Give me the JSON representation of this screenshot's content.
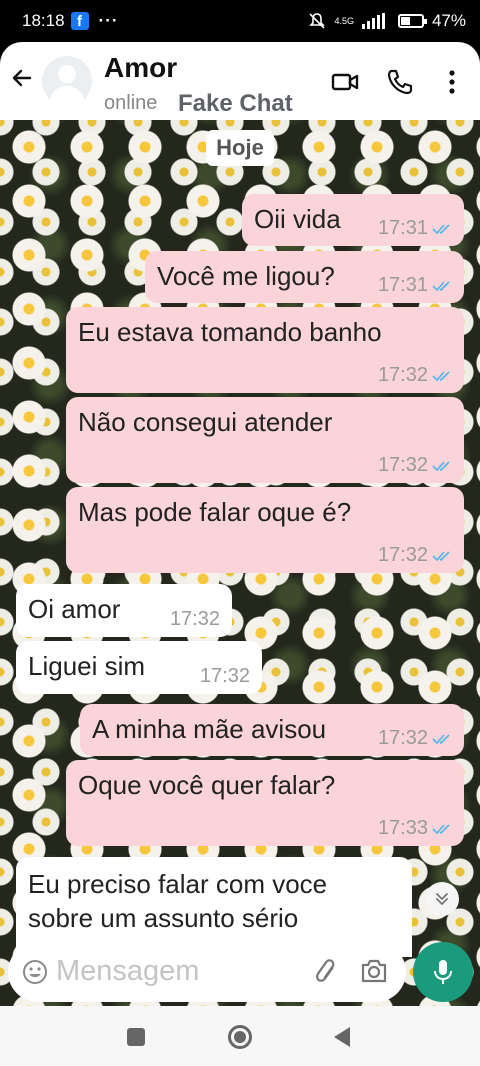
{
  "status_bar": {
    "time": "18:18",
    "app_notification_icon": "facebook-icon",
    "more_dots": "···",
    "network": "4.5G",
    "battery": "47%",
    "battery_level": 0.47
  },
  "header": {
    "contact_name": "Amor",
    "status": "online",
    "watermark": "Fake Chat"
  },
  "chat": {
    "date_label": "Hoje",
    "messages": [
      {
        "dir": "out",
        "text": "Oii vida",
        "time": "17:31"
      },
      {
        "dir": "out",
        "text": "Você me ligou?",
        "time": "17:31"
      },
      {
        "dir": "out",
        "text": "Eu estava tomando banho",
        "time": "17:32"
      },
      {
        "dir": "out",
        "text": "Não consegui atender",
        "time": "17:32"
      },
      {
        "dir": "out",
        "text": "Mas pode falar oque é?",
        "time": "17:32"
      },
      {
        "dir": "in",
        "text": "Oi amor",
        "time": "17:32"
      },
      {
        "dir": "in",
        "text": "Liguei sim",
        "time": "17:32"
      },
      {
        "dir": "out",
        "text": "A minha mãe avisou",
        "time": "17:32"
      },
      {
        "dir": "out",
        "text": "Oque você quer falar?",
        "time": "17:33"
      },
      {
        "dir": "in",
        "text": "Eu preciso falar com voce",
        "text2": "sobre um assunto sério"
      }
    ]
  },
  "input": {
    "placeholder": "Mensagem"
  },
  "colors": {
    "outgoing_bubble": "#fad4d8",
    "incoming_bubble": "#ffffff",
    "mic_button": "#1a9b7d",
    "read_ticks": "#4fb6ec"
  }
}
